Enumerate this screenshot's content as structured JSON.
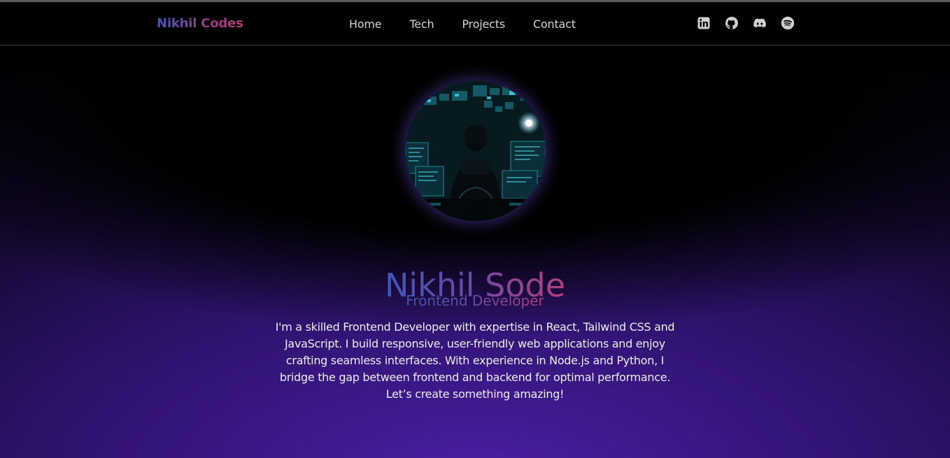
{
  "navbar": {
    "brand": "Nikhil Codes",
    "links": [
      "Home",
      "Tech",
      "Projects",
      "Contact"
    ],
    "socials": [
      {
        "icon": "linkedin-icon"
      },
      {
        "icon": "github-icon"
      },
      {
        "icon": "discord-icon"
      },
      {
        "icon": "spotify-icon"
      }
    ]
  },
  "hero": {
    "name": "Nikhil Sode",
    "role": "Frontend Developer",
    "bio_lines": [
      "I'm a skilled Frontend Developer with expertise in React, Tailwind CSS and",
      "JavaScript. I build responsive, user-friendly web applications and enjoy",
      "crafting seamless interfaces. With experience in Node.js and Python, I",
      "bridge the gap between frontend and backend for optimal performance.",
      "Let’s create something amazing!"
    ]
  },
  "colors": {
    "gradient_start": "#3d58b8",
    "gradient_end": "#b2407a",
    "background_glow": "#4a1fa8",
    "text": "#ececec"
  }
}
